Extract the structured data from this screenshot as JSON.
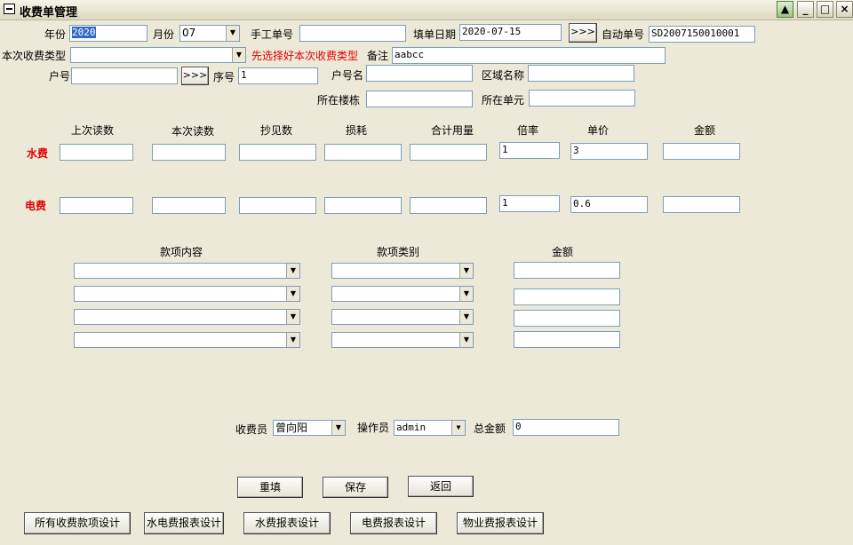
{
  "window": {
    "title": "收费单管理"
  },
  "titlebar": {
    "btn_up": "▲",
    "btn_min": "_",
    "btn_max": "□",
    "btn_close": "×"
  },
  "row1": {
    "year_label": "年份",
    "year_value": "2020",
    "month_label": "月份",
    "month_value": "07",
    "manual_no_label": "手工单号",
    "manual_no_value": "",
    "fill_date_label": "填单日期",
    "fill_date_value": "2020-07-15",
    "more_btn": ">>>",
    "auto_no_label": "自动单号",
    "auto_no_value": "SD2007150010001"
  },
  "row2": {
    "fee_type_label": "本次收费类型",
    "fee_type_value": "",
    "hint": "先选择好本次收费类型",
    "remark_label": "备注",
    "remark_value": "aabcc"
  },
  "row3": {
    "account_label": "户号",
    "account_value": "",
    "more_btn": ">>>",
    "seq_label": "序号",
    "seq_value": "1",
    "account_name_label": "户号名",
    "account_name_value": "",
    "area_label": "区域名称",
    "area_value": ""
  },
  "row4": {
    "building_label": "所在楼栋",
    "building_value": "",
    "unit_label": "所在单元",
    "unit_value": ""
  },
  "meter": {
    "headers": [
      "上次读数",
      "本次读数",
      "抄见数",
      "损耗",
      "合计用量",
      "倍率",
      "单价",
      "金额"
    ],
    "water": {
      "label": "水费",
      "values": [
        "",
        "",
        "",
        "",
        "",
        "1",
        "3",
        ""
      ]
    },
    "electric": {
      "label": "电费",
      "values": [
        "",
        "",
        "",
        "",
        "",
        "1",
        "0.6",
        ""
      ]
    }
  },
  "items": {
    "headers": {
      "content": "款项内容",
      "category": "款项类别",
      "amount": "金额"
    },
    "rows": [
      {
        "content": "",
        "category": "",
        "amount": ""
      },
      {
        "content": "",
        "category": "",
        "amount": ""
      },
      {
        "content": "",
        "category": "",
        "amount": ""
      },
      {
        "content": "",
        "category": "",
        "amount": ""
      }
    ]
  },
  "footer": {
    "collector_label": "收费员",
    "collector_value": "曾向阳",
    "operator_label": "操作员",
    "operator_value": "admin",
    "total_label": "总金额",
    "total_value": "0"
  },
  "actions": {
    "reset": "重填",
    "save": "保存",
    "back": "返回"
  },
  "design_buttons": [
    "所有收费款项设计",
    "水电费报表设计",
    "水费报表设计",
    "电费报表设计",
    "物业费报表设计"
  ]
}
